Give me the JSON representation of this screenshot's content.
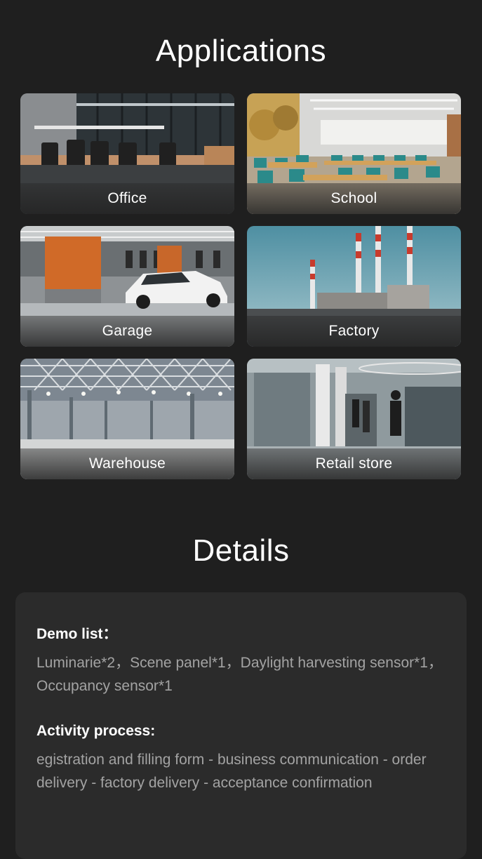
{
  "applications": {
    "title": "Applications",
    "items": [
      {
        "label": "Office"
      },
      {
        "label": "School"
      },
      {
        "label": "Garage"
      },
      {
        "label": "Factory"
      },
      {
        "label": "Warehouse"
      },
      {
        "label": "Retail store"
      }
    ]
  },
  "details": {
    "title": "Details",
    "demo_list": {
      "heading": "Demo list：",
      "text": "Luminarie*2，Scene panel*1，Daylight harvesting sensor*1，Occupancy sensor*1"
    },
    "activity_process": {
      "heading": "Activity process:",
      "text": "egistration and filling form - business communication - order delivery - factory delivery - acceptance confirmation"
    }
  },
  "colors": {
    "background": "#1f1f1f",
    "card_background": "#2b2b2b",
    "body_text": "#a3a3a3",
    "heading_text": "#ffffff"
  }
}
